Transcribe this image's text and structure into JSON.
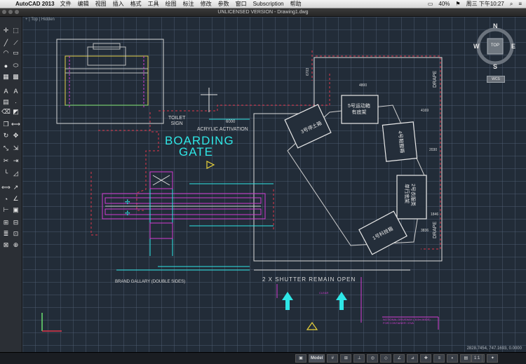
{
  "menubar": {
    "app_name": "AutoCAD 2013",
    "items": [
      "文件",
      "编辑",
      "视图",
      "插入",
      "格式",
      "工具",
      "绘图",
      "标注",
      "修改",
      "参数",
      "窗口",
      "Subscription",
      "帮助"
    ],
    "status": {
      "battery": "40%",
      "datetime": "周三 下午10:27"
    }
  },
  "window": {
    "title": "UNLICENSED VERSION - Drawing1.dwg"
  },
  "viewport": {
    "label": "+ | Top | Hidden"
  },
  "viewcube": {
    "top": "TOP",
    "n": "N",
    "s": "S",
    "e": "E",
    "w": "W",
    "wcs": "WCS"
  },
  "drawing": {
    "boarding_gate": "BOARDING",
    "boarding_gate_2": "GATE",
    "toilet": "TOILET",
    "toilet_2": "SIGN",
    "acrylic": "ACRYLIC ACTIVATION",
    "shutter": "2 X SHUTTER REMAIN OPEN",
    "brand_gallery": "BRAND GALLARY (DOUBLE SIDES)",
    "clear": "CLEAR",
    "drape_1": "DRAPE",
    "drape_2": "DRAPE",
    "booth_1": "3号停土箱",
    "booth_2": "5号运动箱",
    "booth_2b": "有底架",
    "booth_3": "4号鞋服箱",
    "booth_4": "2号衣服类",
    "booth_4b": "单行底架",
    "booth_5": "1号科技箱",
    "dim_6000": "6000",
    "dim_4800": "4800",
    "dim_4169": "4169",
    "dim_2030": "2030",
    "dim_3836": "3836",
    "dim_6703": "6703",
    "dim_1846": "1846",
    "notional": "NOTIONAL DRIVEWAY ( 8.0m WIDE)",
    "notional_2": "FOR CONTAINER / EVA"
  },
  "statusbar": {
    "coords": "2828.7454, 747.1693, 0.0000",
    "model_tab": "Model",
    "scale": "1:1"
  },
  "colors": {
    "canvas": "#222c38",
    "accent_cyan": "#2ee6e6",
    "magenta": "#d23bd2",
    "red_dash": "#e0364a"
  }
}
